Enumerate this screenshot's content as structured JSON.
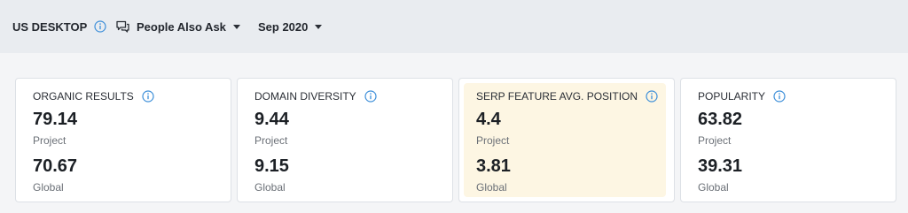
{
  "header": {
    "device": "US DESKTOP",
    "feature": "People Also Ask",
    "date": "Sep 2020"
  },
  "cards": [
    {
      "title": "ORGANIC RESULTS",
      "project_value": "79.14",
      "project_label": "Project",
      "global_value": "70.67",
      "global_label": "Global"
    },
    {
      "title": "DOMAIN DIVERSITY",
      "project_value": "9.44",
      "project_label": "Project",
      "global_value": "9.15",
      "global_label": "Global"
    },
    {
      "title": "SERP FEATURE AVG. POSITION",
      "project_value": "4.4",
      "project_label": "Project",
      "global_value": "3.81",
      "global_label": "Global",
      "highlighted": true
    },
    {
      "title": "POPULARITY",
      "project_value": "63.82",
      "project_label": "Project",
      "global_value": "39.31",
      "global_label": "Global"
    }
  ],
  "colors": {
    "info_icon": "#3d8fd9",
    "highlight_bg": "#fdf6e3"
  },
  "icons": {
    "info": "info-icon",
    "feature": "chat-bubble-icon",
    "dropdown": "chevron-down-icon"
  }
}
